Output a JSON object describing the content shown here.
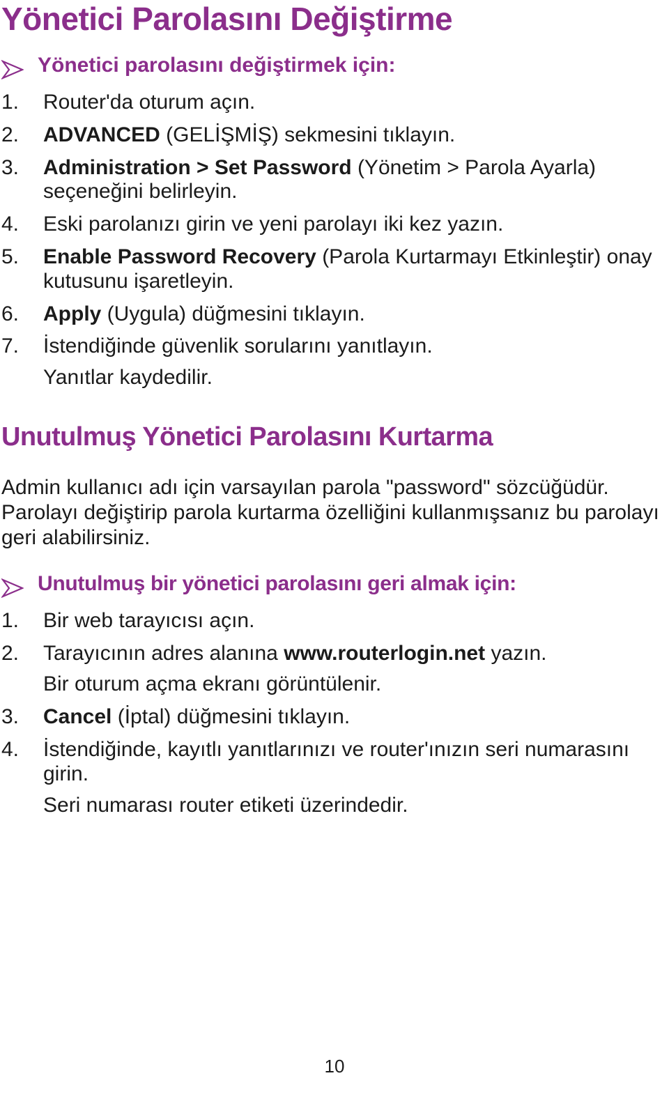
{
  "document": {
    "title": "Yönetici Parolasını Değiştirme",
    "page_number": "10",
    "accent_color": "#8B2E8B",
    "text_color": "#1b1b1b",
    "background_color": "#ffffff"
  },
  "section_change_password": {
    "bullet_icon": "arrow-bullet-icon",
    "bullet_label": "Yönetici parolasını değiştirmek için:",
    "steps": [
      {
        "num": "1.",
        "parts": [
          {
            "text": "Router'da oturum açın.",
            "bold": false
          }
        ]
      },
      {
        "num": "2.",
        "parts": [
          {
            "text": "ADVANCED ",
            "bold": true
          },
          {
            "text": "(GELİŞMİŞ) sekmesini tıklayın.",
            "bold": false
          }
        ]
      },
      {
        "num": "3.",
        "parts": [
          {
            "text": "Administration > Set Password ",
            "bold": true
          },
          {
            "text": "(Yönetim > Parola Ayarla) seçeneğini belirleyin.",
            "bold": false
          }
        ]
      },
      {
        "num": "4.",
        "parts": [
          {
            "text": "Eski parolanızı girin ve yeni parolayı iki kez yazın.",
            "bold": false
          }
        ]
      },
      {
        "num": "5.",
        "parts": [
          {
            "text": "Enable Password Recovery ",
            "bold": true
          },
          {
            "text": "(Parola Kurtarmayı Etkinleştir) onay kutusunu işaretleyin.",
            "bold": false
          }
        ]
      },
      {
        "num": "6.",
        "parts": [
          {
            "text": "Apply ",
            "bold": true
          },
          {
            "text": "(Uygula) düğmesini tıklayın.",
            "bold": false
          }
        ]
      },
      {
        "num": "7.",
        "parts": [
          {
            "text": "İstendiğinde güvenlik sorularını yanıtlayın.",
            "bold": false
          }
        ],
        "note": "Yanıtlar kaydedilir."
      }
    ]
  },
  "section_recover_password": {
    "heading": "Unutulmuş Yönetici Parolasını Kurtarma",
    "paragraph": "Admin kullanıcı adı için varsayılan parola \"password\" sözcüğüdür. Parolayı değiştirip parola kurtarma özelliğini kullanmışsanız bu parolayı geri alabilirsiniz.",
    "bullet_icon": "arrow-bullet-icon",
    "bullet_label": "Unutulmuş bir yönetici parolasını geri almak için:",
    "steps": [
      {
        "num": "1.",
        "parts": [
          {
            "text": "Bir web tarayıcısı açın.",
            "bold": false
          }
        ]
      },
      {
        "num": "2.",
        "parts": [
          {
            "text": "Tarayıcının adres alanına ",
            "bold": false
          },
          {
            "text": "www.routerlogin.net",
            "bold": true
          },
          {
            "text": " yazın.",
            "bold": false
          }
        ],
        "note": "Bir oturum açma ekranı görüntülenir."
      },
      {
        "num": "3.",
        "parts": [
          {
            "text": "Cancel ",
            "bold": true
          },
          {
            "text": "(İptal) düğmesini tıklayın.",
            "bold": false
          }
        ]
      },
      {
        "num": "4.",
        "parts": [
          {
            "text": "İstendiğinde, kayıtlı yanıtlarınızı ve router'ınızın seri numarasını girin.",
            "bold": false
          }
        ],
        "note": "Seri numarası router etiketi üzerindedir."
      }
    ]
  }
}
